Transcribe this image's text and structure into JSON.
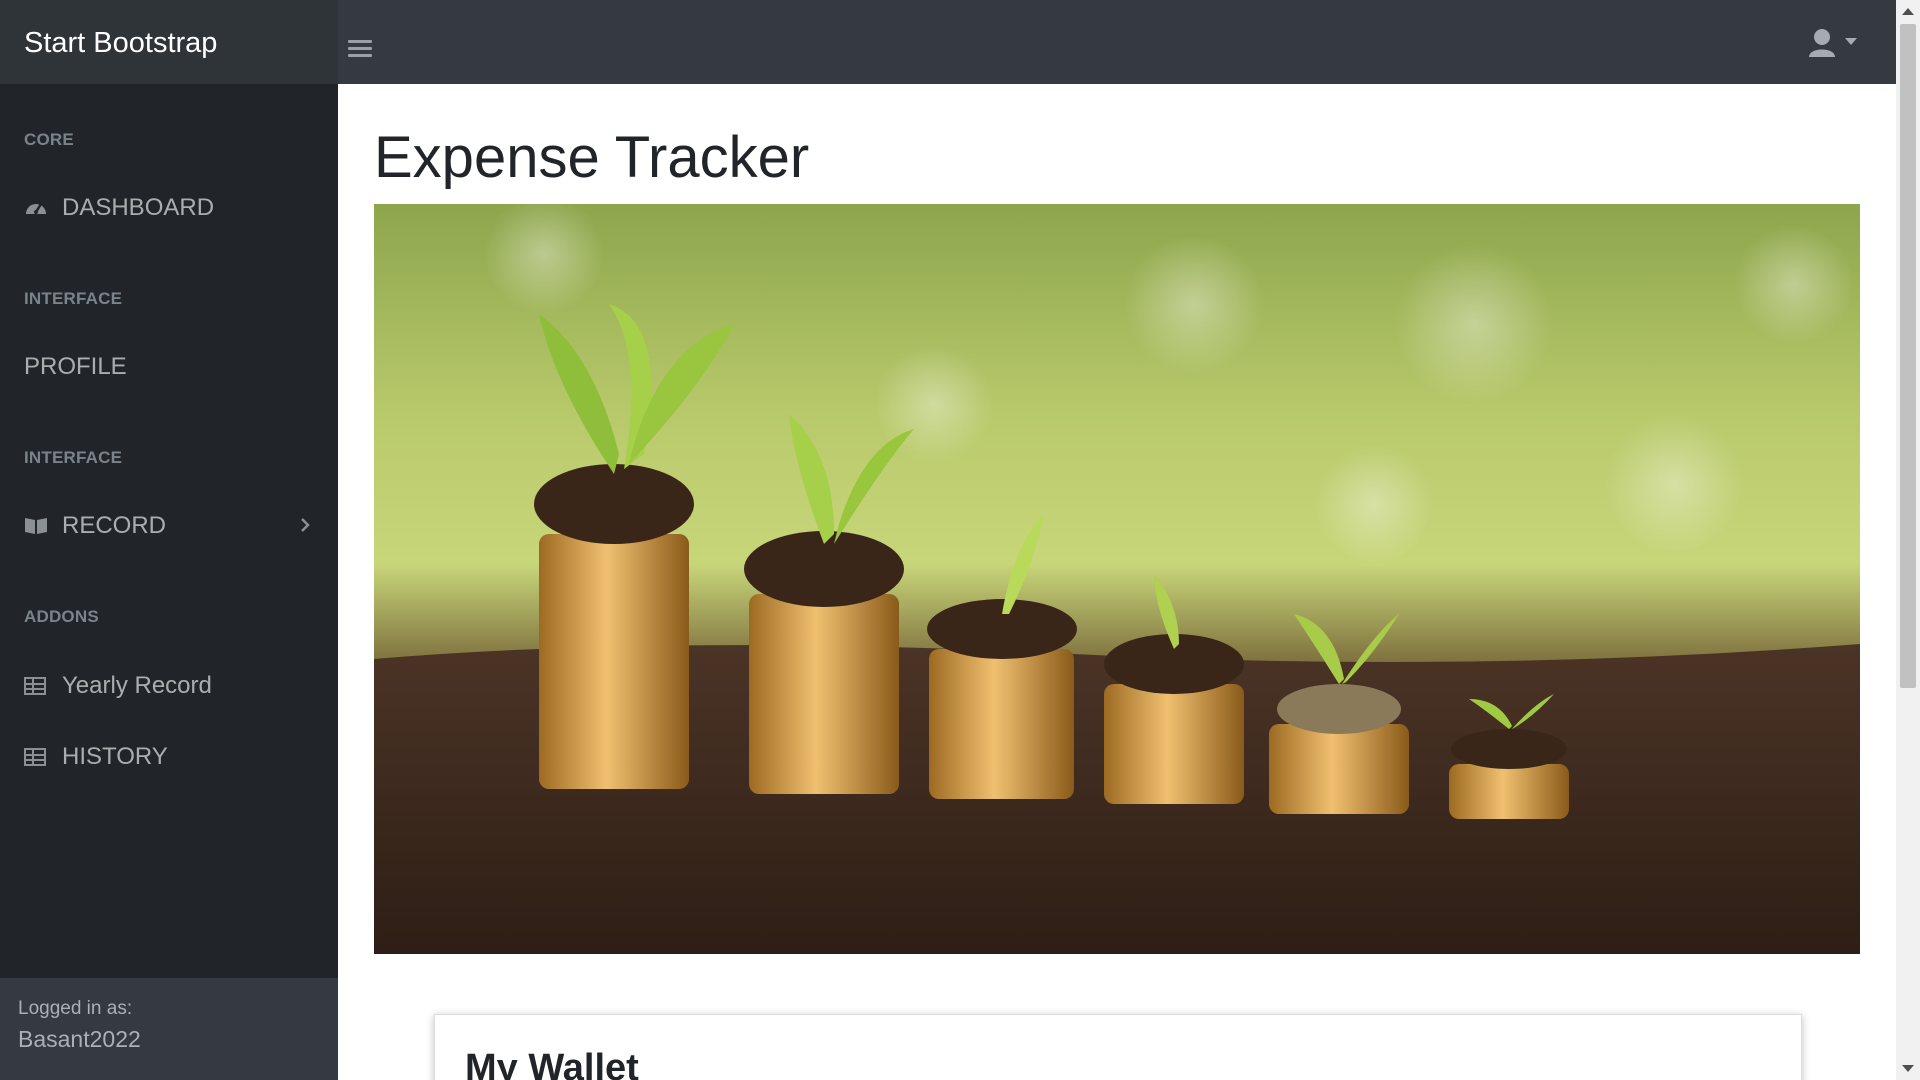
{
  "brand": "Start Bootstrap",
  "sidebar": {
    "headings": [
      "CORE",
      "INTERFACE",
      "INTERFACE",
      "ADDONS"
    ],
    "items": [
      {
        "label": "DASHBOARD",
        "icon": "gauge-icon"
      },
      {
        "label": "PROFILE",
        "icon": ""
      },
      {
        "label": "RECORD",
        "icon": "book-icon"
      },
      {
        "label": "Yearly Record",
        "icon": "table-icon"
      },
      {
        "label": "HISTORY",
        "icon": "table-icon"
      }
    ],
    "footer": {
      "logged_in_label": "Logged in as:",
      "username": "Basant2022"
    }
  },
  "main": {
    "title": "Expense Tracker",
    "card_title": "My Wallet"
  },
  "colors": {
    "navbar": "#343a40",
    "sidebar": "#212529",
    "brand_bg": "#2f3439"
  }
}
